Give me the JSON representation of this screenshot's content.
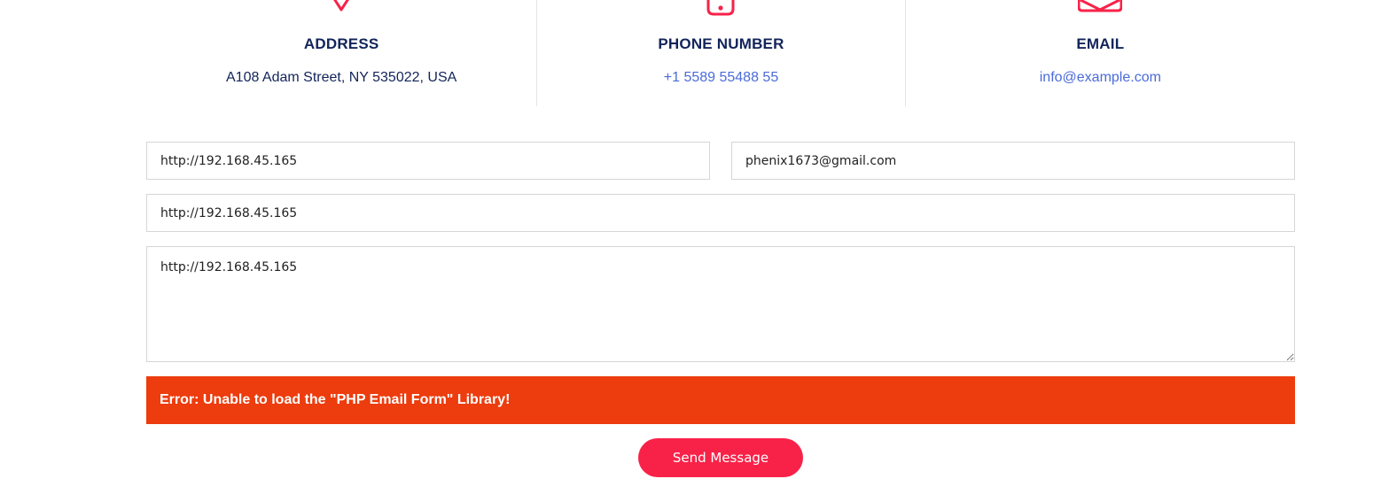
{
  "contact_info": {
    "address": {
      "icon": "map-pin-icon",
      "title": "ADDRESS",
      "value": "A108 Adam Street, NY 535022, USA"
    },
    "phone": {
      "icon": "phone-icon",
      "title": "PHONE NUMBER",
      "value": "+1 5589 55488 55"
    },
    "email": {
      "icon": "envelope-icon",
      "title": "EMAIL",
      "value": "info@example.com"
    }
  },
  "form": {
    "name_value": "http://192.168.45.165",
    "email_value": "phenix1673@gmail.com",
    "subject_value": "http://192.168.45.165",
    "message_value": "http://192.168.45.165",
    "error_message": "Error: Unable to load the \"PHP Email Form\" Library!",
    "submit_label": "Send Message"
  },
  "colors": {
    "accent": "#f82249",
    "heading": "#12245a",
    "link": "#4b6bd8",
    "error_bg": "#ed3c0d"
  }
}
